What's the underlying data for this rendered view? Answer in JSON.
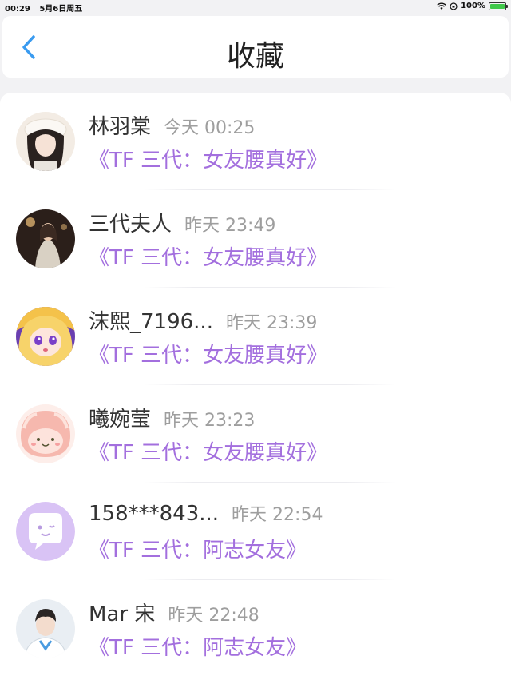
{
  "status_bar": {
    "time": "00:29",
    "date": "5月6日周五",
    "battery": "100%"
  },
  "header": {
    "title": "收藏"
  },
  "favorites": [
    {
      "name": "林羽棠",
      "time": "今天 00:25",
      "title": "《TF 三代：女友腰真好》"
    },
    {
      "name": "三代夫人",
      "time": "昨天 23:49",
      "title": "《TF 三代：女友腰真好》"
    },
    {
      "name": "沫熙_7196...",
      "time": "昨天 23:39",
      "title": "《TF 三代：女友腰真好》"
    },
    {
      "name": "曦婉莹",
      "time": "昨天 23:23",
      "title": "《TF 三代：女友腰真好》"
    },
    {
      "name": "158***843...",
      "time": "昨天 22:54",
      "title": "《TF 三代：阿志女友》"
    },
    {
      "name": "Mar 宋",
      "time": "昨天 22:48",
      "title": "《TF 三代：阿志女友》"
    }
  ],
  "colors": {
    "accent": "#3a9bf0",
    "title_purple": "#a36fde",
    "time_gray": "#9e9e9e"
  }
}
